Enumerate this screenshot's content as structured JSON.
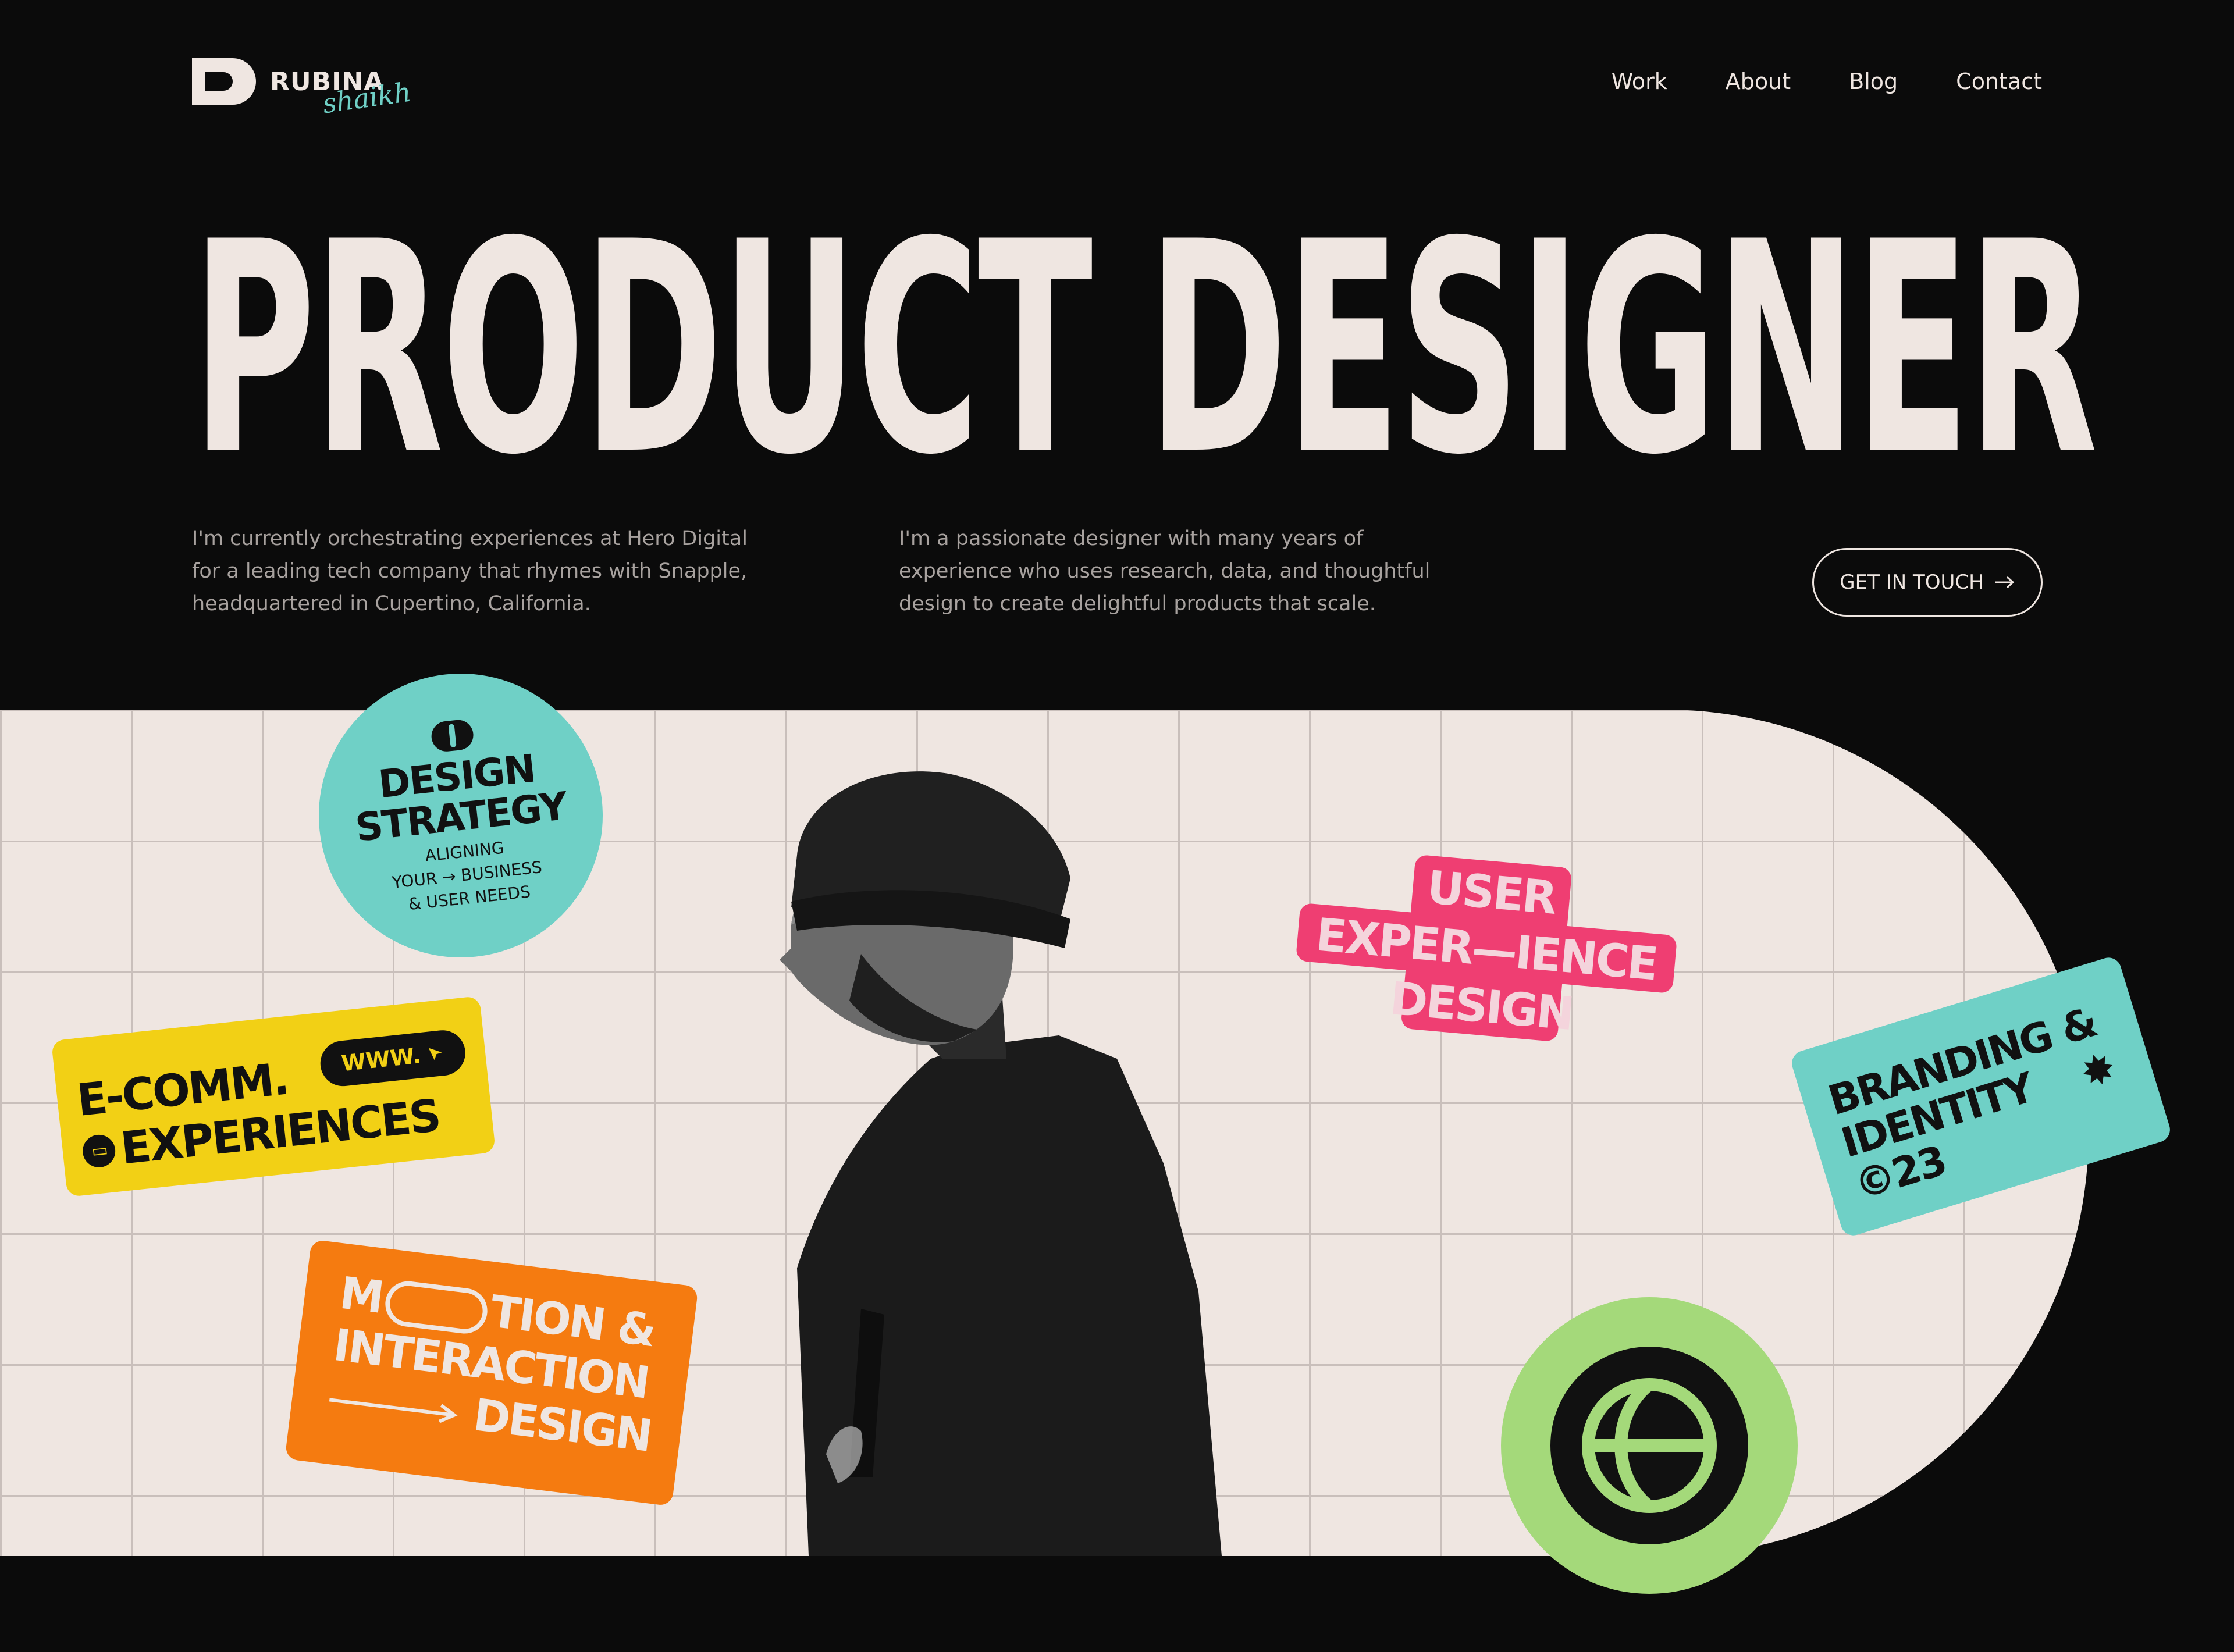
{
  "brand": {
    "name": "RUBINA",
    "script": "shaikh"
  },
  "nav": {
    "work": "Work",
    "about": "About",
    "blog": "Blog",
    "contact": "Contact"
  },
  "hero": {
    "title": "PRODUCT DESIGNER",
    "intro_left": "I'm currently orchestrating experiences at Hero Digital for a leading tech company that rhymes with Snapple, headquartered in Cupertino, California.",
    "intro_mid": "I'm a passionate designer with many years of experience who uses research, data, and thoughtful design to create delightful products that scale.",
    "cta": "GET IN TOUCH"
  },
  "stickers": {
    "design_strategy": {
      "line1": "DESIGN",
      "line2": "STRATEGY",
      "small1": "ALIGNING",
      "small2": "YOUR → BUSINESS",
      "small3": "& USER NEEDS"
    },
    "ecomm": {
      "line1": "E-COMM.",
      "www": "WWW.",
      "line2": "EXPERIENCES"
    },
    "motion": {
      "line1a": "M",
      "line1b": "TION &",
      "line2": "INTERACTION",
      "line3": "DESIGN"
    },
    "ux": {
      "line1": "USER",
      "line2": "EXPER—IENCE",
      "line3": "DESIGN"
    },
    "branding": {
      "line1": "BRANDING &",
      "line2": "IDENTITY",
      "line3": "©23"
    }
  },
  "colors": {
    "background": "#0b0b0b",
    "cream": "#efe6e1",
    "teal": "#6fd0c6",
    "yellow": "#f2d015",
    "orange": "#f57b10",
    "pink": "#ef3e72",
    "green": "#a4d97a"
  },
  "icons": [
    "logo-mark-icon",
    "arrow-right-icon",
    "cursor-icon",
    "monitor-icon",
    "starburst-icon",
    "globe-icon"
  ]
}
